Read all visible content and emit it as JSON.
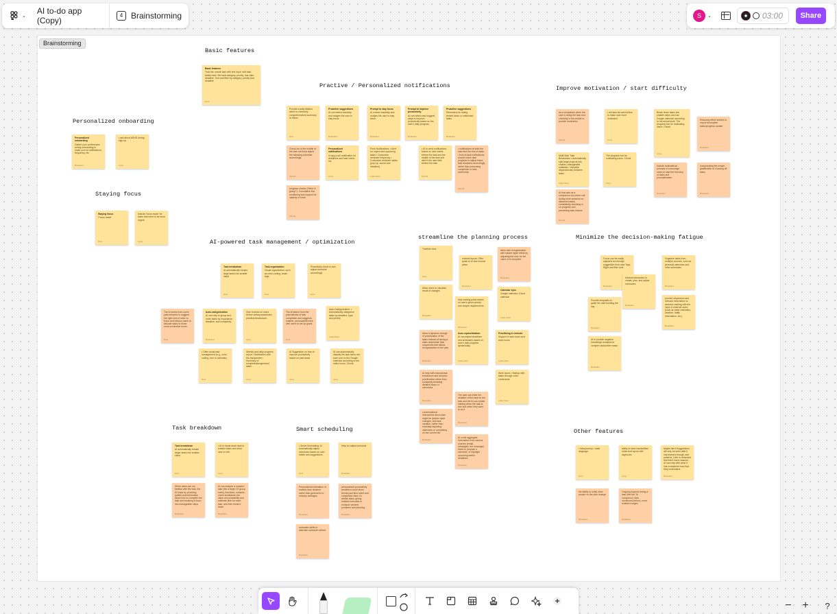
{
  "header": {
    "file_name": "AI to-do app (Copy)",
    "page_count": "4",
    "page_name": "Brainstorming",
    "avatar": "S",
    "timer": "03:00",
    "share": "Share"
  },
  "section_label": "Brainstorming",
  "groups": [
    {
      "title": "Basic features"
    },
    {
      "title": "Practive / Personalized notifications"
    },
    {
      "title": "Improve motivation / start difficulty"
    },
    {
      "title": "Personalized onboarding"
    },
    {
      "title": "Staying focus"
    },
    {
      "title": "AI-powered task management / optimization"
    },
    {
      "title": "streamline the planning process"
    },
    {
      "title": "Minimize the decision-making fatigue"
    },
    {
      "title": "Task breakdown"
    },
    {
      "title": "Smart scheduling"
    },
    {
      "title": "Other features"
    }
  ],
  "notes": [
    {
      "h": "Basic features",
      "t": "Todo list: create task with text input, edit task, delete task. Set task category, priority, due date, deadline. Sort and filter by category, priority and deadline",
      "by": "Dani"
    },
    {
      "h": "",
      "t": "Provide a daily tiltation which is cheerfully comprehensived summary to follow.",
      "by": "Dani"
    },
    {
      "h": "Proactive suggestions",
      "t": "AI can detect inactivity and nudges the user to stay focus",
      "by": "Breakfast"
    },
    {
      "h": "Prompt to stay focus",
      "t": "AI notices inactivity and nudges the user to stay focus",
      "by": "Breakfast"
    },
    {
      "h": "Prompt to improve productivity",
      "t": "AI can detect and suggest ways to improve productivity based on the user's daily progress",
      "by": "Breakfast"
    },
    {
      "h": "Proactive suggestions",
      "t": "Reminders for falling behind tasks or unfinished tasks",
      "by": "Breakfast"
    },
    {
      "h": "",
      "t": "Check-ins in the middle of the task and help adjust the following schedule accordingly.",
      "by": "Morhal"
    },
    {
      "h": "Personalized notifications",
      "t": "In-app push notification for deadlines and task check-ins",
      "by": "Aung"
    },
    {
      "h": "",
      "t": "Push Notifications: • Alert for urgent and upcoming tasks • Customize reminder frequency • Customize reminder styles (pop-up, sound and vibration)",
      "by": "Lalita Swar"
    },
    {
      "h": "",
      "t": "• AI to send notifications based on user habits before the task and the middle of the task and alert if the user falls behind the task",
      "by": "Morhal"
    },
    {
      "h": "",
      "t": "• notifications at both the start and the end of tasks. • End-of-task notifications should check task progress to adjust future task durations accordingly, rather than presuming completion or task ownership.",
      "by": "Morhal"
    },
    {
      "h": "",
      "t": "progress checks ('Were is going?'). Cumulative this monitoring and support for staying on track.",
      "by": "Morhal"
    },
    {
      "h": "",
      "t": "as a companion when the user is doing the task and checking in the middle to provide motivation.",
      "by": "Morhal"
    },
    {
      "h": "",
      "t": "• set task list and folders to make user more motivated",
      "by": "Aung"
    },
    {
      "h": "",
      "t": "Break down tasks into smaller steps and use Google calendar according to the actual work. The progress bar for motivating users. Chunk",
      "by": "Aung"
    },
    {
      "h": "",
      "t": "Reducing effort needed to report incomplete tasks/progress update",
      "by": "Breakfast"
    },
    {
      "h": "",
      "t": "Multi-Step Task Breakdown • Automatically split large projects into smaller, manageable subtasks • Visualize dependencies between tasks",
      "by": "Lalita Swar"
    },
    {
      "h": "",
      "t": "The progress bar for motivating users. Chunk",
      "by": "Aung"
    },
    {
      "h": "",
      "t": "Include motivational prompts to encourage users to start the first step of tasks and procrastination.",
      "by": "Breakfast"
    },
    {
      "h": "",
      "t": "Incorporating the simple gratification of crossing off tasks",
      "by": "Breakfast"
    },
    {
      "h": "",
      "t": "AI that acts as a companion via phone call during work sessions on distracted tasks, consistently checking in on progress and preventing task misses.",
      "by": "Morhal"
    },
    {
      "h": "Personalized onboarding",
      "t": "Gather your preferences during onboarding to make your AI notifications, frequency, etc",
      "by": "Breakfast"
    },
    {
      "h": "",
      "t": "• ask about ADHD during sign up",
      "by": "Aung"
    },
    {
      "h": "Staying focus",
      "t": "'Focus mode'",
      "by": "Dani"
    },
    {
      "h": "",
      "t": "Include 'focus mode' for tasks that need to be done urgent",
      "by": "Aung"
    },
    {
      "h": "Task breakdown",
      "t": "AI automatically breaks large tasks into smaller steps",
      "by": "Dani"
    },
    {
      "h": "Task organization",
      "t": "Visual organization, such as color-coding, smart tags",
      "by": "Dani"
    },
    {
      "h": "",
      "t": "Proactively check in and adjust schedule accordingly",
      "by": "Dani"
    },
    {
      "h": "",
      "t": "The AI works from users past behavior to suggest the right kind of order to focus and refocus users to allocate tasks to those more productive hours.",
      "by": "Dani"
    },
    {
      "h": "Auto-categorization",
      "t": "AI can help to group and order tasks by importance, deadline, and complexity",
      "by": "Breakfast"
    },
    {
      "h": "",
      "t": "Give reviews on users before setting tasks/rules prioritize/breakdown",
      "by": "Aung"
    },
    {
      "h": "",
      "t": "The AI learns from the past failures of task completion and suggests smarter, personalized time with users to set up goals.",
      "by": "Dani"
    },
    {
      "h": "",
      "t": "Auto-Categorization: • Automatically categorize tasks by deadline, type, and priority",
      "by": "Lalita Swar"
    },
    {
      "h": "",
      "t": "• Offer visual task management (e.g., color coding, lock to calendar)",
      "by": "Dani"
    },
    {
      "h": "",
      "t": "Weekly and daily progress report • Notification with the Assignment • Summary of completed/progressed tasks",
      "by": "Aung"
    },
    {
      "h": "",
      "t": "AI Suggestion on how to improve productivity based on past tasks",
      "by": "Aung"
    },
    {
      "h": "",
      "t": "AI can automatically classify the task items into each one so the Google calendar according to the editor hours. Chunk",
      "by": "Aung"
    },
    {
      "h": "",
      "t": "Timeline view",
      "by": "Dani"
    },
    {
      "h": "",
      "t": "minimal inputs: Offer goals to AI and receive plans",
      "by": "Breakfast"
    },
    {
      "h": "",
      "t": "allow task reorganization with instant ripple effect by adjusting the user for the value of to complete.",
      "by": "Breakfast"
    },
    {
      "h": "",
      "t": "Allow users to visualize result of changes",
      "by": "Breakfast"
    },
    {
      "h": "",
      "t": "help making plans based on user's given priority and unique requirements",
      "by": "Breakfast"
    },
    {
      "h": "Calendar sync",
      "t": "Google calendar, iCloud calendar",
      "by": "Lalita Swar"
    },
    {
      "h": "",
      "t": "Allow a dynamic change of prioritization of the tasks instead of having a static sequential Task sequences that allows reorganization of the plan",
      "by": "Breakfast"
    },
    {
      "h": "Auto reprioritization",
      "t": "AI can adjust deadlines and schedules based on user's task progress dynamically.",
      "by": "Lalita Swar"
    },
    {
      "h": "Prioritizing & reminds",
      "t": "Support to task hours and work hours",
      "by": "Lalita Swar"
    },
    {
      "h": "",
      "t": "AI help with manual task breakdown and decision prioritization rather than constantly breaking detailed steps or schedules",
      "by": "Breakfast"
    },
    {
      "h": "",
      "t": "Work hours • Startup with tasks through voice commands",
      "by": "Lalita Swar"
    },
    {
      "h": "",
      "t": "The user can enter the deadline of the task for the task and the AI can create starting when the task is due and when they want to do it",
      "by": "Breakfast"
    },
    {
      "h": "",
      "t": "conversational interactions about plan might be quicker input changes, and task creation, rather than manually adjusting calendars or completing on the current list",
      "by": "Breakfast"
    },
    {
      "h": "",
      "t": "AI could aggregate information from various sources (email, messages, the message). Need to propose a schedule, or highlight upcoming earlier deadlines",
      "by": "Breakfast"
    },
    {
      "h": "",
      "t": "Focus can be easily adjusted via through suggestion from task Taps Right and filter rank",
      "by": "Breakfast"
    },
    {
      "h": "",
      "t": "Organize tasks from multiple sources, such as personal calendars and other schedules",
      "by": "Breakfast"
    },
    {
      "h": "",
      "t": "Minimal interaction to create, plan, and adjust schedules",
      "by": "Breakfast"
    },
    {
      "h": "",
      "t": "Provide templates to guide the start building the day",
      "by": "Breakfast"
    },
    {
      "h": "",
      "t": "provide responsive and relevant information to decision-making with the input of external users (such as other calendars, weather, traffic information, etc.)",
      "by": "Breakfast"
    },
    {
      "h": "",
      "t": "AI to provide negative knowledge analysis for complex tasks/other tasks",
      "by": "Breakfast"
    },
    {
      "h": "Task breakdown",
      "t": "AI automatically breaks larger tasks into smaller steps",
      "by": "Dani"
    },
    {
      "h": "",
      "t": "• AI to break down task to smaller tasks and allow user to edit",
      "by": "Aung"
    },
    {
      "h": "",
      "t": "When users are not familiar with the task, the AI helps by providing guides and information about how to complete the task and breaking it down into manageable steps",
      "by": "Breakfast"
    },
    {
      "h": "",
      "t": "AI can analyze a complex task (like a large CS group meet), functions, contacts. Users breakdown the steps and probability and estimate time for each task, and then break it down",
      "by": "Breakfast"
    },
    {
      "h": "",
      "t": "• Smart Scheduling: AI automatically adjust schedules based on user habits and suggestions",
      "by": "Dani"
    },
    {
      "h": "",
      "t": "Help for adjust schedule",
      "by": "Breakfast"
    },
    {
      "h": "",
      "t": "Personalized estimation of realistic task duration rather than general AI or industry averages",
      "by": "Breakfast"
    },
    {
      "h": "",
      "t": "personalized productivity prediction could show trends past time spent and completion rates on similar tasks, giving realistic forecasts to enhance prevent problems and planning",
      "by": "Breakfast"
    },
    {
      "h": "",
      "t": "automatic shifts to alternate schedule criteria",
      "by": "Breakfast"
    },
    {
      "h": "",
      "t": "• Idea journey • math language",
      "by": "Dani"
    },
    {
      "h": "",
      "t": "ability to save handwritten notes and syncs with daybooks",
      "by": "Aung"
    },
    {
      "h": "",
      "t": "Maybe like if suggestions will only be seen after it has learned enough user patterns. User is reminded that there have reasons: AI can help with what it has considered how that they understand.",
      "by": "Breakfast"
    },
    {
      "h": "",
      "t": "the ability to notify other people on the plan change",
      "by": "Breakfast"
    },
    {
      "h": "",
      "t": "Ongoing support during a task (like the 'AI companion' idea mentioned before), more realistic nudges",
      "by": "Breakfast"
    }
  ]
}
